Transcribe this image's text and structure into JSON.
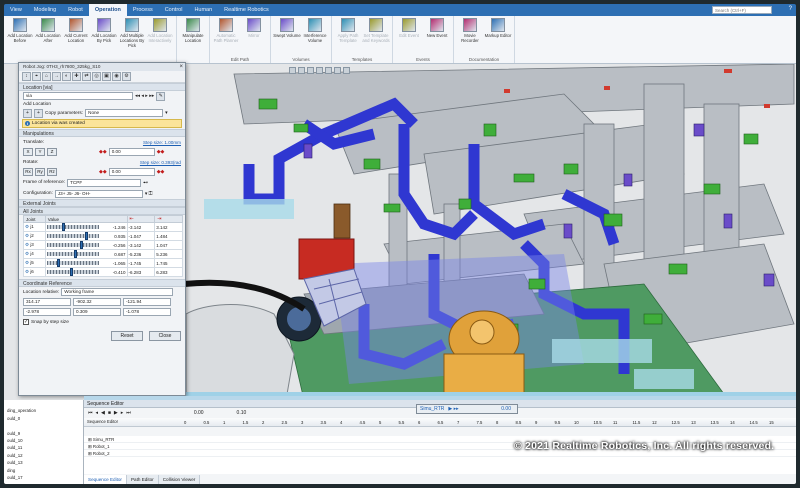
{
  "ribbon_tabs": [
    "View",
    "Modeling",
    "Robot",
    "Operation",
    "Process",
    "Control",
    "Human",
    "Realtime Robotics"
  ],
  "active_tab": "Operation",
  "search_placeholder": "Search (Ctrl+F)",
  "ribbon": {
    "groups": [
      {
        "name": "",
        "buttons": [
          "Add Location Before",
          "Add Location After",
          "Add Current Location",
          "Add Location By Pick",
          "Add Multiple Locations By Pick",
          "Add Location Interactively"
        ]
      },
      {
        "name": "",
        "buttons": [
          "Manipulate Location"
        ]
      },
      {
        "name": "Edit Path",
        "buttons": [
          "Automatic Path Planner",
          "Mirror"
        ]
      },
      {
        "name": "Volumes",
        "buttons": [
          "Swept Volume",
          "Interference Volume"
        ]
      },
      {
        "name": "Templates",
        "buttons": [
          "Apply Path Template",
          "Set Template and Keywords"
        ]
      },
      {
        "name": "Events",
        "buttons": [
          "Edit Event",
          "New Event"
        ]
      },
      {
        "name": "Documentation",
        "buttons": [
          "Movie Recorder",
          "Markup Editor"
        ]
      }
    ]
  },
  "dialog": {
    "title": "Robot Jog: 0TH3_rh7800_325kg_S10",
    "location_section": "Location [via]",
    "location_value": "via",
    "add_location_label": "Add Location",
    "copy_params_label": "Copy parameters:",
    "copy_params_value": "None",
    "info_message": "Location via was created",
    "manipulations_section": "Manipulations",
    "translate_label": "Translate:",
    "translate_step": "Step size: 1.00mm",
    "translate_value": "0.00",
    "rotate_label": "Rotate:",
    "rotate_step": "Step size: 0.393(rad",
    "rotate_value": "0.00",
    "axes_t": [
      "X",
      "Y",
      "Z"
    ],
    "axes_r": [
      "Rx",
      "Ry",
      "Rz"
    ],
    "frame_label": "Frame of reference:",
    "frame_value": "TCPF",
    "config_label": "Configuration:",
    "config_value": "J3+ J5- J6- OH-",
    "external_joints_section": "External Joints",
    "all_joints_section": "All Joints",
    "joint_headers": [
      "Joint",
      "Value",
      "",
      ""
    ],
    "joints": [
      {
        "name": "j1",
        "value": "-1.246",
        "lo": "-3.142",
        "hi": "3.142",
        "pos": 0.3
      },
      {
        "name": "j2",
        "value": "0.935",
        "lo": "-1.047",
        "hi": "1.484",
        "pos": 0.78
      },
      {
        "name": "j3",
        "value": "-0.256",
        "lo": "-3.142",
        "hi": "1.047",
        "pos": 0.68
      },
      {
        "name": "j4",
        "value": "0.687",
        "lo": "-5.236",
        "hi": "5.236",
        "pos": 0.56
      },
      {
        "name": "j5",
        "value": "-1.065",
        "lo": "-1.745",
        "hi": "1.745",
        "pos": 0.2
      },
      {
        "name": "j6",
        "value": "-0.410",
        "lo": "-6.283",
        "hi": "6.283",
        "pos": 0.46
      }
    ],
    "coord_section": "Coordinate Reference",
    "location_relative_label": "Location relative:",
    "location_relative_value": "Working frame",
    "coords_row1": [
      "314.17",
      "-902.32",
      "-121.94"
    ],
    "coords_row2": [
      "-2.978",
      "0.309",
      "-1.078"
    ],
    "snap_label": "Snap by step size",
    "reset_label": "Reset",
    "close_label": "Close"
  },
  "copyright": "© 2021 Realtime Robotics, Inc. All rights reserved.",
  "sim_bar": {
    "label": "Simu_RTR",
    "time": "0.00"
  },
  "tree_items": [
    "",
    "ding_operation",
    "ould_0",
    "",
    "ould_9",
    "ould_10",
    "ould_11",
    "ould_12",
    "ould_13",
    "ding",
    "ould_17"
  ],
  "sequence": {
    "title": "Sequence Editor",
    "time_value": "0.00",
    "step_value": "0.10",
    "ruler_label": "Sequence Editor",
    "ruler_ticks": [
      "0",
      "0.5",
      "1",
      "1.5",
      "2",
      "2.5",
      "3",
      "3.5",
      "4",
      "4.5",
      "5",
      "5.5",
      "6",
      "6.5",
      "7",
      "7.5",
      "8",
      "8.5",
      "9",
      "9.5",
      "10",
      "10.5",
      "11",
      "11.5",
      "12",
      "12.5",
      "13",
      "13.5",
      "14",
      "14.5",
      "15"
    ],
    "lanes": [
      "Simu_RTR",
      "Robot_1",
      "Robot_2"
    ],
    "tabs": [
      "Sequence Editor",
      "Path Editor",
      "Collision Viewer"
    ]
  }
}
